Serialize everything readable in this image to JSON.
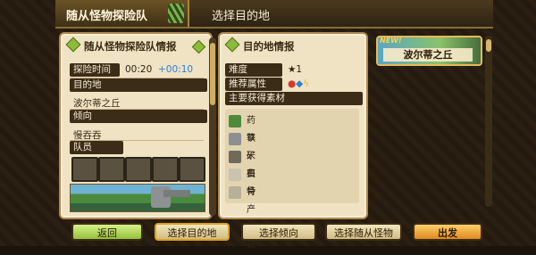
{
  "header": {
    "title": "随从怪物探险队",
    "subtitle": "选择目的地"
  },
  "expedition_info": {
    "heading": "随从怪物探险队情报",
    "time_label": "探险时间",
    "time_value": "00:20",
    "time_bonus": "+00:10",
    "destination_label": "目的地",
    "destination_value": "波尔蒂之丘",
    "tendency_label": "倾向",
    "tendency_value": "慢吞吞",
    "members_label": "队员"
  },
  "destination_info": {
    "heading": "目的地情报",
    "difficulty_label": "难度",
    "difficulty_value": "1",
    "attribute_label": "推荐属性",
    "materials_label": "主要获得素材",
    "materials": [
      {
        "name": "药草",
        "icon": "herb-icon"
      },
      {
        "name": "铁矿石",
        "icon": "ore-icon"
      },
      {
        "name": "米虫",
        "icon": "bug-icon"
      },
      {
        "name": "兽骨",
        "icon": "bone-icon"
      },
      {
        "name": "特产蘑菇",
        "icon": "mushroom-icon"
      }
    ]
  },
  "destination_card": {
    "new_badge": "NEW!",
    "name": "波尔蒂之丘"
  },
  "buttons": {
    "back": "返回",
    "select_destination": "选择目的地",
    "select_tendency": "选择倾向",
    "select_monster": "选择随从怪物",
    "depart": "出发"
  },
  "colors": {
    "accent_green": "#95c13a",
    "accent_orange": "#e08a1e",
    "bonus_blue": "#2e7fd6"
  }
}
